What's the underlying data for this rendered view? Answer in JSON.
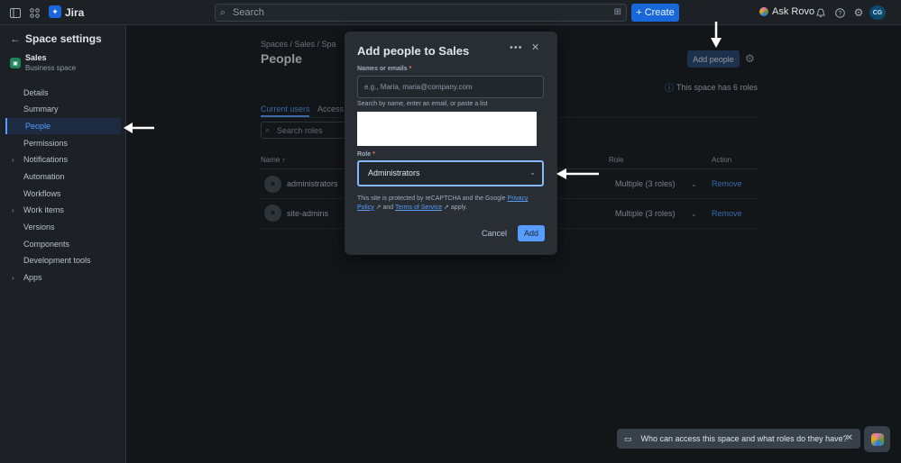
{
  "topbar": {
    "app_name": "Jira",
    "search_placeholder": "Search",
    "create_label": "Create",
    "ask_rovo_label": "Ask Rovo",
    "avatar_initials": "CG"
  },
  "sidebar": {
    "header": "Space settings",
    "space_name": "Sales",
    "space_type": "Business space",
    "items": [
      {
        "label": "Details"
      },
      {
        "label": "Summary"
      },
      {
        "label": "People",
        "active": true
      },
      {
        "label": "Permissions"
      },
      {
        "label": "Notifications",
        "expandable": true
      },
      {
        "label": "Automation"
      },
      {
        "label": "Workflows"
      },
      {
        "label": "Work items",
        "expandable": true
      },
      {
        "label": "Versions"
      },
      {
        "label": "Components"
      },
      {
        "label": "Development tools"
      },
      {
        "label": "Apps",
        "expandable": true
      }
    ]
  },
  "main": {
    "breadcrumb": "Spaces  /  Sales  /  Spa",
    "title": "People",
    "add_people_label": "Add people",
    "roles_info": "This space has 6 roles",
    "tabs": [
      {
        "label": "Current users",
        "active": true
      },
      {
        "label": "Access"
      }
    ],
    "search_roles_placeholder": "Search roles",
    "table": {
      "headers": [
        "Name",
        "Role",
        "Action"
      ],
      "rows": [
        {
          "name": "administrators",
          "role": "Multiple (3 roles)",
          "action": "Remove"
        },
        {
          "name": "site-admins",
          "role": "Multiple (3 roles)",
          "action": "Remove"
        }
      ]
    }
  },
  "modal": {
    "title": "Add people to Sales",
    "names_label": "Names or emails",
    "names_placeholder": "e.g., Maria, maria@company.com",
    "names_helper": "Search by name, enter an email, or paste a list",
    "role_label": "Role",
    "role_value": "Administrators",
    "captcha_text_1": "This site is protected by reCAPTCHA and the Google ",
    "captcha_privacy": "Privacy Policy",
    "captcha_and": " and ",
    "captcha_terms": "Terms of Service",
    "captcha_apply": " apply.",
    "cancel_label": "Cancel",
    "add_label": "Add"
  },
  "chat_prompt": "Who can access this space and what roles do they have?",
  "colors": {
    "accent": "#579dff",
    "primary_button": "#1868db",
    "background": "#1d2125"
  }
}
